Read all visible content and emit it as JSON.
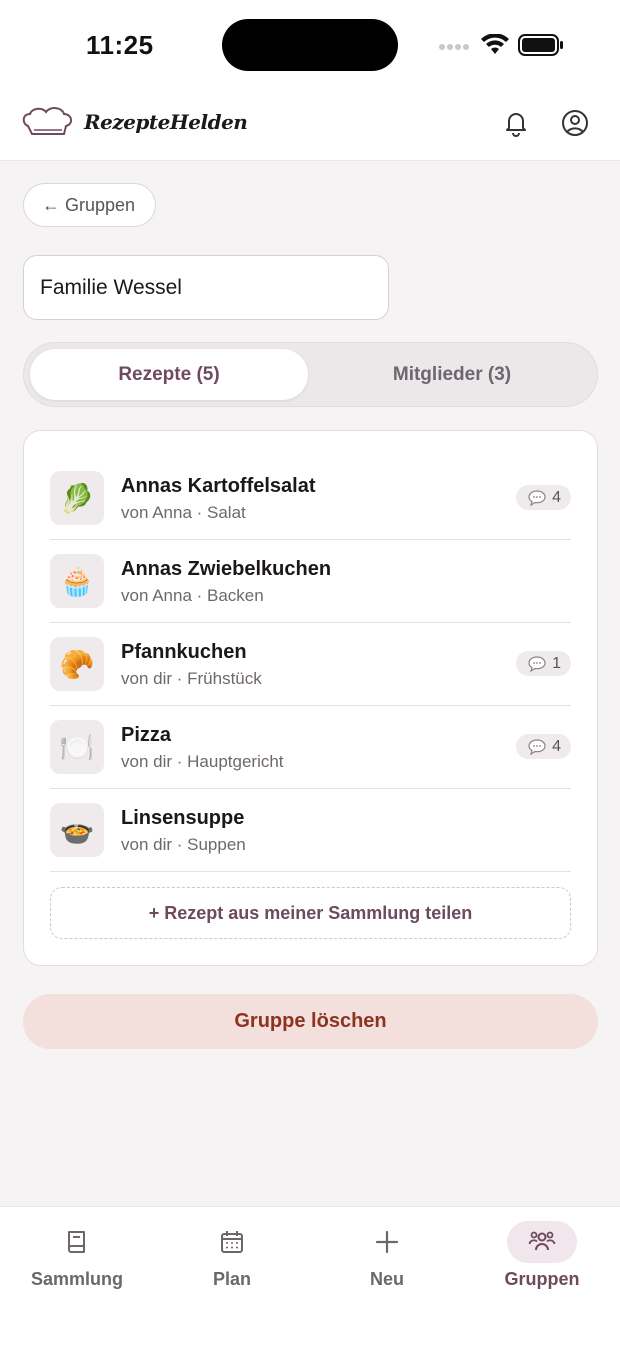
{
  "status_bar": {
    "time": "11:25"
  },
  "header": {
    "brand": "RezepteHelden",
    "icons": [
      "bell-icon",
      "account-icon"
    ]
  },
  "back_button": {
    "label": "← Gruppen"
  },
  "group": {
    "name": "Familie Wessel"
  },
  "tabs": [
    {
      "label": "Rezepte (5)",
      "active": true
    },
    {
      "label": "Mitglieder (3)",
      "active": false
    }
  ],
  "recipes": [
    {
      "title": "Annas Kartoffelsalat",
      "meta": "von Anna · Salat",
      "emoji": "🥬",
      "comments": "4"
    },
    {
      "title": "Annas Zwiebelkuchen",
      "meta": "von Anna · Backen",
      "emoji": "🧁",
      "comments": null
    },
    {
      "title": "Pfannkuchen",
      "meta": "von dir · Frühstück",
      "emoji": "🥐",
      "comments": "1"
    },
    {
      "title": "Pizza",
      "meta": "von dir · Hauptgericht",
      "emoji": "🍽️",
      "comments": "4"
    },
    {
      "title": "Linsensuppe",
      "meta": "von dir · Suppen",
      "emoji": "🍲",
      "comments": null
    }
  ],
  "share_button": {
    "label": "+ Rezept aus meiner Sammlung teilen"
  },
  "delete_button": {
    "label": "Gruppe löschen"
  },
  "bottom_nav": [
    {
      "label": "Sammlung",
      "icon": "book-icon",
      "active": false
    },
    {
      "label": "Plan",
      "icon": "calendar-icon",
      "active": false
    },
    {
      "label": "Neu",
      "icon": "plus-icon",
      "active": false
    },
    {
      "label": "Gruppen",
      "icon": "group-icon",
      "active": true
    }
  ],
  "colors": {
    "accent": "#6e4a5e",
    "danger_text": "#8c3420",
    "danger_bg": "#f3dfdb",
    "background": "#f6f3f4"
  }
}
